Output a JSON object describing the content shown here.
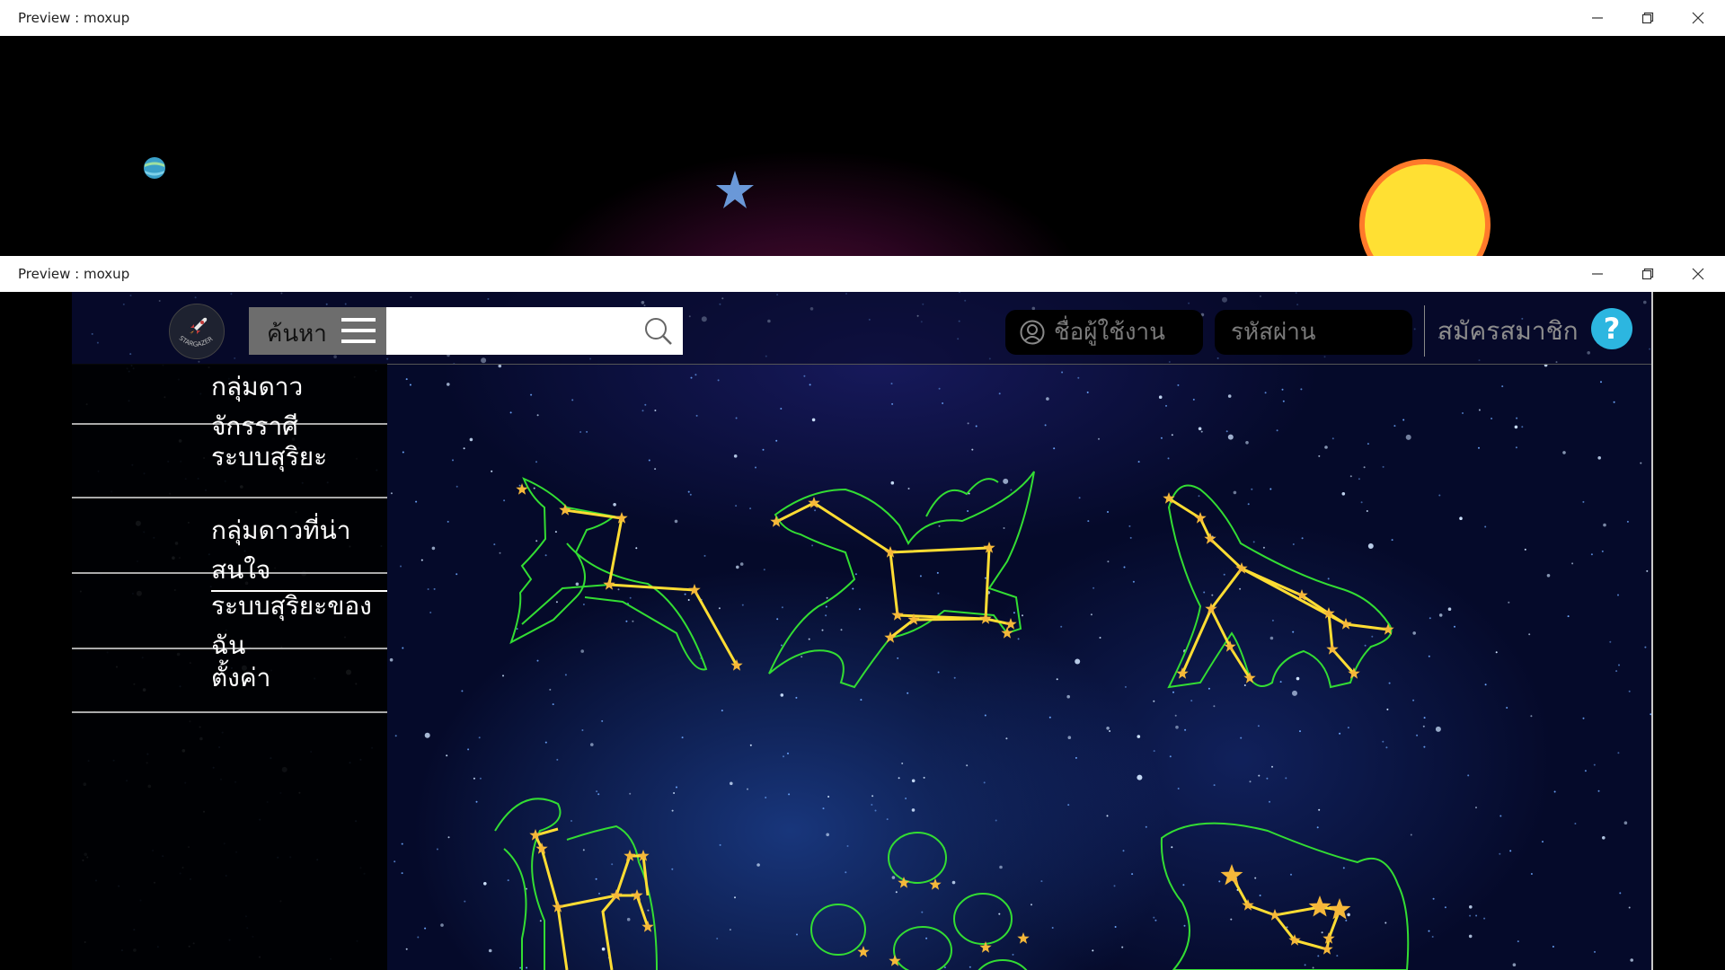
{
  "window_top": {
    "title": "Preview : moxup"
  },
  "window_bottom": {
    "title": "Preview : moxup"
  },
  "header": {
    "search_label": "ค้นหา",
    "search_value": "",
    "username_placeholder": "ชื่อผู้ใช้งาน",
    "password_placeholder": "รหัสผ่าน",
    "register_label": "สมัครสมาชิก",
    "help_label": "?"
  },
  "logo": {
    "text": "STARGAZER"
  },
  "sidebar": {
    "items": [
      {
        "label": "กลุ่มดาวจักรราศี"
      },
      {
        "label": "ระบบสุริยะ"
      },
      {
        "label": "กลุ่มดาวที่น่าสนใจ"
      },
      {
        "label": "ระบบสุริยะของฉัน"
      },
      {
        "label": "ตั้งค่า"
      }
    ]
  },
  "colors": {
    "constellation_outline": "#33dd33",
    "constellation_line": "#ffdd33",
    "star": "#f5b83a",
    "help_button": "#2cb6e0",
    "sun": "#ffe033"
  },
  "icons": [
    "minimize-icon",
    "maximize-icon",
    "close-icon",
    "rocket-icon",
    "menu-icon",
    "search-icon",
    "user-icon",
    "help-icon",
    "planet-icon",
    "star-icon",
    "sun-icon"
  ]
}
